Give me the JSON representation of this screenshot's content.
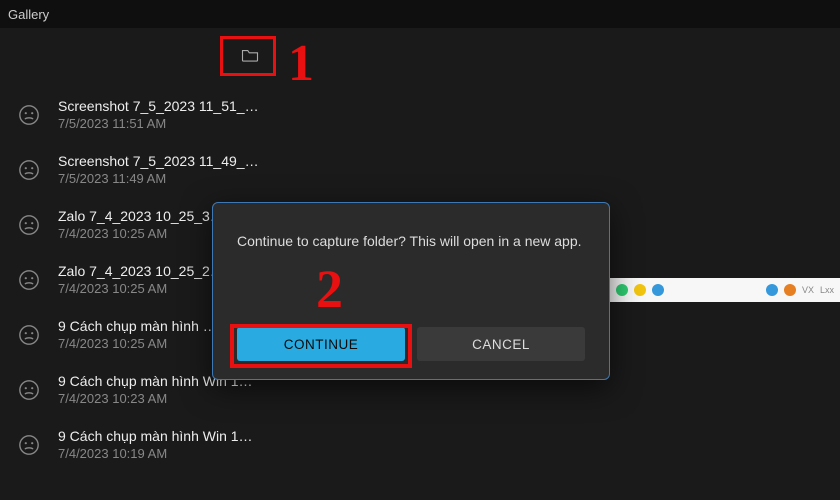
{
  "header": {
    "title": "Gallery"
  },
  "folder_button": {
    "icon": "folder-icon"
  },
  "annotations": {
    "one": "1",
    "two": "2"
  },
  "items": [
    {
      "name": "Screenshot 7_5_2023 11_51_…",
      "date": "7/5/2023 11:51 AM"
    },
    {
      "name": "Screenshot 7_5_2023 11_49_…",
      "date": "7/5/2023 11:49 AM"
    },
    {
      "name": "Zalo 7_4_2023 10_25_3…",
      "date": "7/4/2023 10:25 AM"
    },
    {
      "name": "Zalo 7_4_2023 10_25_2…",
      "date": "7/4/2023 10:25 AM"
    },
    {
      "name": "9 Cách chụp màn hình …",
      "date": "7/4/2023 10:25 AM"
    },
    {
      "name": "9 Cách chụp màn hình Win 1…",
      "date": "7/4/2023 10:23 AM"
    },
    {
      "name": "9 Cách chụp màn hình Win 1…",
      "date": "7/4/2023 10:19 AM"
    }
  ],
  "dialog": {
    "message": "Continue to capture folder? This will open in a new app.",
    "continue_label": "CONTINUE",
    "cancel_label": "CANCEL"
  },
  "colors": {
    "highlight": "#e81010",
    "primary_button": "#29abe2",
    "dialog_border": "#3e78b4"
  }
}
